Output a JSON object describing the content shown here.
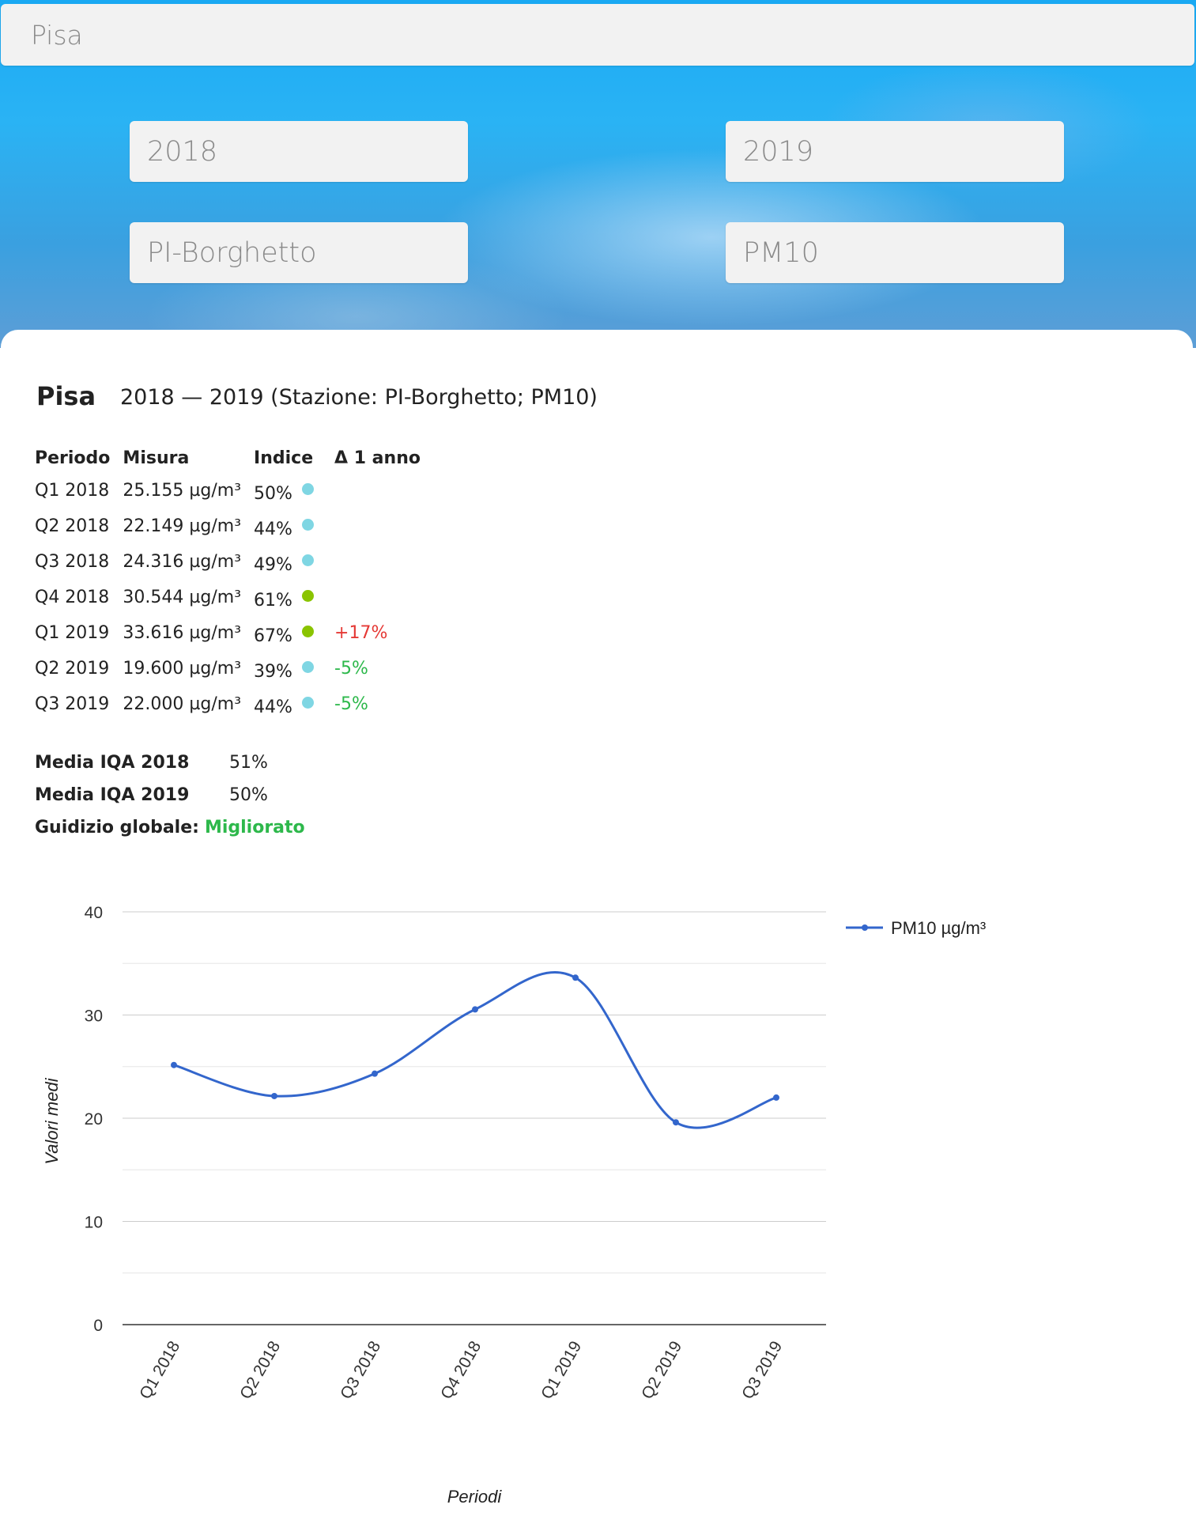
{
  "search": {
    "city_value": "Pisa"
  },
  "filters": {
    "year_from": "2018",
    "year_to": "2019",
    "station": "PI-Borghetto",
    "pollutant": "PM10"
  },
  "report": {
    "city": "Pisa",
    "subtitle": "2018 — 2019 (Stazione: PI-Borghetto; PM10)",
    "headers": {
      "period": "Periodo",
      "measure": "Misura",
      "index": "Indice",
      "delta": "Δ 1 anno"
    },
    "rows": [
      {
        "period": "Q1 2018",
        "measure": "25.155 µg/m³",
        "index": "50%",
        "dot_color": "#7fd6e3",
        "delta": ""
      },
      {
        "period": "Q2 2018",
        "measure": "22.149 µg/m³",
        "index": "44%",
        "dot_color": "#7fd6e3",
        "delta": ""
      },
      {
        "period": "Q3 2018",
        "measure": "24.316 µg/m³",
        "index": "49%",
        "dot_color": "#7fd6e3",
        "delta": ""
      },
      {
        "period": "Q4 2018",
        "measure": "30.544 µg/m³",
        "index": "61%",
        "dot_color": "#8ac400",
        "delta": ""
      },
      {
        "period": "Q1 2019",
        "measure": "33.616 µg/m³",
        "index": "67%",
        "dot_color": "#8ac400",
        "delta": "+17%",
        "delta_sign": "pos"
      },
      {
        "period": "Q2 2019",
        "measure": "19.600 µg/m³",
        "index": "39%",
        "dot_color": "#7fd6e3",
        "delta": "-5%",
        "delta_sign": "neg"
      },
      {
        "period": "Q3 2019",
        "measure": "22.000 µg/m³",
        "index": "44%",
        "dot_color": "#7fd6e3",
        "delta": "-5%",
        "delta_sign": "neg"
      }
    ],
    "summary": {
      "media_2018_label": "Media IQA 2018",
      "media_2018_value": "51%",
      "media_2019_label": "Media IQA 2019",
      "media_2019_value": "50%",
      "judgement_label": "Guidizio globale:",
      "judgement_value": "Migliorato",
      "judgement_color": "#2db84b"
    }
  },
  "chart_data": {
    "type": "line",
    "categories": [
      "Q1 2018",
      "Q2 2018",
      "Q3 2018",
      "Q4 2018",
      "Q1 2019",
      "Q2 2019",
      "Q3 2019"
    ],
    "series": [
      {
        "name": "PM10 µg/m³",
        "values": [
          25.155,
          22.149,
          24.316,
          30.544,
          33.616,
          19.6,
          22.0
        ],
        "color": "#3366cc"
      }
    ],
    "xlabel": "Periodi",
    "ylabel": "Valori medi",
    "ylim": [
      0,
      40
    ],
    "yticks": [
      0,
      10,
      20,
      30,
      40
    ],
    "grid": true,
    "legend_position": "right"
  }
}
